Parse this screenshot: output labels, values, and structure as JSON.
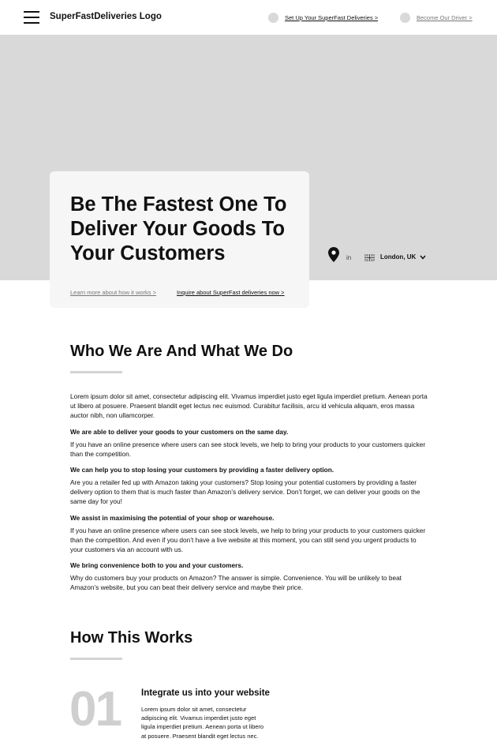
{
  "header": {
    "logo": "SuperFastDeliveries Logo",
    "setup_link": "Set Up Your SuperFast Deliveries >",
    "driver_link": "Become Our Driver >"
  },
  "hero": {
    "title": "Be The Fastest One To Deliver Your Goods To Your Customers",
    "learn_link": "Learn more about how it works >",
    "inquire_link": "Inquire about SuperFast deliveries now >",
    "location": {
      "in_label": "in",
      "city": "London, UK"
    }
  },
  "who": {
    "title": "Who We Are And What We Do",
    "intro": "Lorem ipsum dolor sit amet, consectetur adipiscing elit. Vivamus imperdiet justo eget ligula imperdiet pretium. Aenean porta ut libero at posuere. Praesent blandit eget lectus nec euismod. Curabitur facilisis, arcu id vehicula aliquam, eros massa auctor nibh, non ullamcorper.",
    "blocks": [
      {
        "heading": "We are able to deliver your goods to your customers on the same day.",
        "text": "If you have an online presence where users can see stock levels, we help to bring your products to your customers quicker than the competition."
      },
      {
        "heading": "We can help you to stop losing your customers by providing a faster delivery option.",
        "text": "Are you a retailer fed up with Amazon taking your customers? Stop losing your potential customers by providing a faster delivery option to them that is much faster than Amazon’s delivery service. Don’t forget, we can deliver your goods on the same day for you!"
      },
      {
        "heading": "We assist in maximising the potential of your shop or warehouse.",
        "text": "If you have an online presence where users can see stock levels, we help to bring your products to your customers quicker than the competition. And even if you don’t have a live website at this moment, you can still send you urgent products to your customers via an account with us."
      },
      {
        "heading": "We bring convenience both to you and your customers.",
        "text": "Why do customers buy your products on Amazon? The answer is simple. Convenience. You will be unlikely to beat Amazon’s website, but you can beat their delivery service and maybe their price."
      }
    ]
  },
  "how": {
    "title": "How This Works",
    "steps": [
      {
        "number": "01",
        "title": "Integrate us into your website",
        "text": "Lorem ipsum dolor sit amet, consectetur adipiscing elit. Vivamus imperdiet justo eget ligula imperdiet pretium. Aenean porta ut libero at posuere. Praesent blandit eget lectus nec."
      }
    ]
  },
  "colors": {
    "hero_background": "#d9d9d9",
    "card_background": "#f6f6f6",
    "rule": "#d4d4d4",
    "step_number": "#cfcfcf"
  },
  "icons": [
    "menu-icon",
    "map-pin-icon",
    "uk-flag-icon",
    "chevron-down-icon"
  ]
}
